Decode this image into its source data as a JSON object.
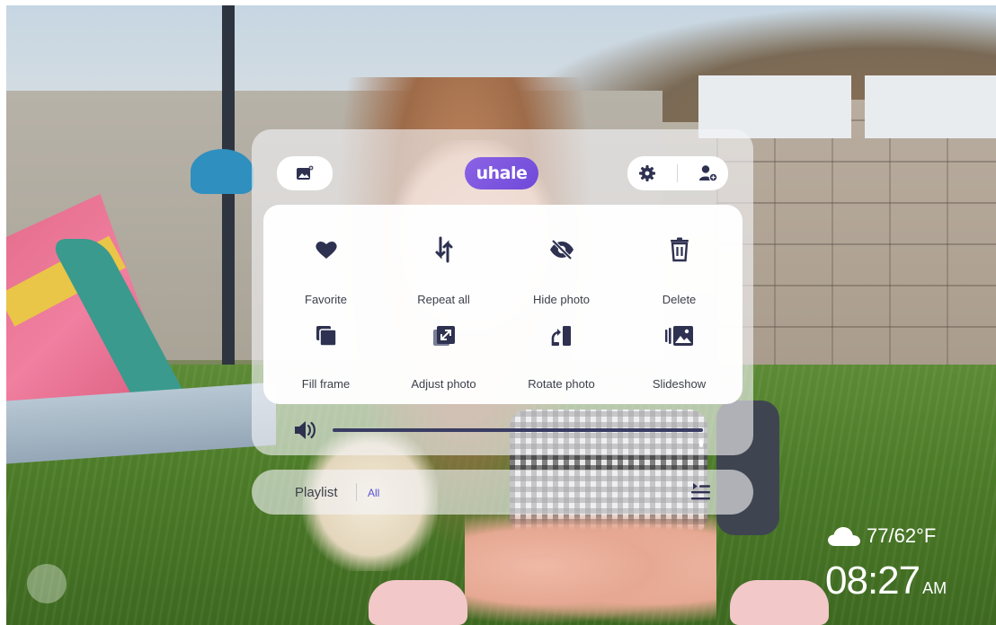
{
  "header": {
    "logo_text": "uhale",
    "gallery_icon": "gallery-add-icon",
    "settings_icon": "gear-icon",
    "account_icon": "add-user-icon"
  },
  "actions": [
    {
      "label": "Favorite",
      "icon": "heart-icon"
    },
    {
      "label": "Repeat all",
      "icon": "repeat-arrows-icon"
    },
    {
      "label": "Hide photo",
      "icon": "eye-off-icon"
    },
    {
      "label": "Delete",
      "icon": "trash-icon"
    },
    {
      "label": "Fill frame",
      "icon": "fill-frame-icon"
    },
    {
      "label": "Adjust photo",
      "icon": "adjust-photo-icon"
    },
    {
      "label": "Rotate photo",
      "icon": "rotate-photo-icon"
    },
    {
      "label": "Slideshow",
      "icon": "slideshow-icon"
    }
  ],
  "volume": {
    "level_percent": 100,
    "icon": "speaker-icon"
  },
  "playlist": {
    "label": "Playlist",
    "filter": "All",
    "icon": "playlist-icon"
  },
  "weather": {
    "text": "77/62°F",
    "icon": "cloud-icon"
  },
  "clock": {
    "time": "08:27",
    "ampm": "AM"
  },
  "colors": {
    "accent": "#6f49d8",
    "icon": "#2e3150",
    "text": "#3c3e4a",
    "link": "#5b52d6"
  }
}
